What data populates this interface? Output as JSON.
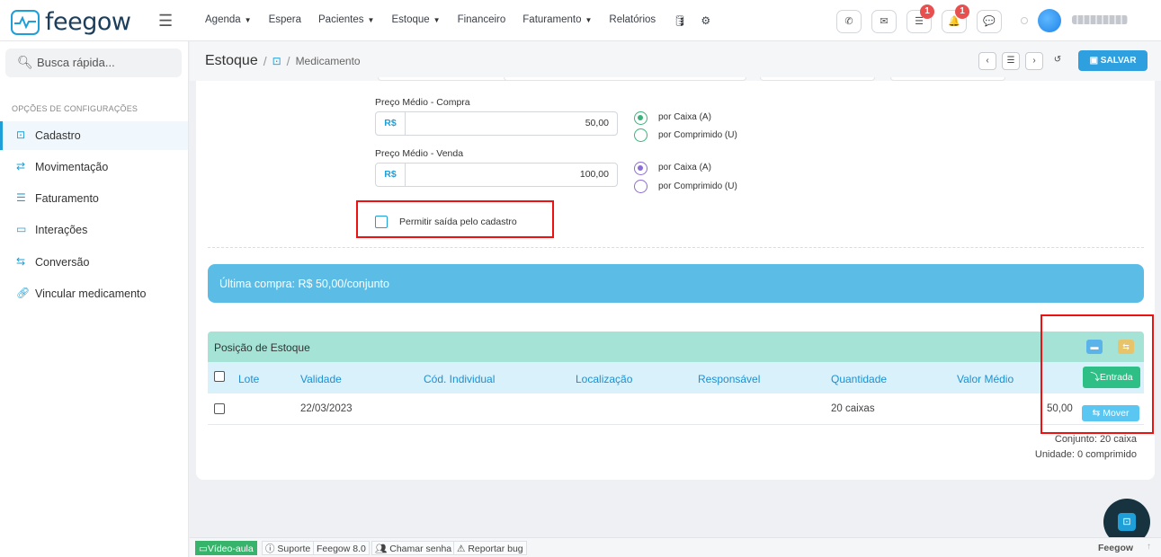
{
  "app": {
    "logo_text": "feegow"
  },
  "nav": {
    "items": [
      {
        "label": "Agenda",
        "caret": true
      },
      {
        "label": "Espera",
        "caret": false
      },
      {
        "label": "Pacientes",
        "caret": true
      },
      {
        "label": "Estoque",
        "caret": true
      },
      {
        "label": "Financeiro",
        "caret": false
      },
      {
        "label": "Faturamento",
        "caret": true
      },
      {
        "label": "Relatórios",
        "caret": false
      }
    ],
    "icons": [
      "database-icon",
      "gear-icon"
    ]
  },
  "topbar": {
    "buttons": [
      "phone-icon",
      "inbox-icon",
      "tasks-icon",
      "bell-icon",
      "chat-icon"
    ],
    "tasks_badge": "1",
    "bell_badge": "1"
  },
  "sidebar": {
    "search_placeholder": "Busca rápida...",
    "section_title": "OPÇÕES DE CONFIGURAÇÕES",
    "items": [
      {
        "label": "Cadastro",
        "icon": "box-icon",
        "active": true
      },
      {
        "label": "Movimentação",
        "icon": "arrows-icon",
        "active": false
      },
      {
        "label": "Faturamento",
        "icon": "list-icon",
        "active": false
      },
      {
        "label": "Interações",
        "icon": "folder-icon",
        "active": false
      },
      {
        "label": "Conversão",
        "icon": "convert-icon",
        "active": false
      },
      {
        "label": "Vincular medicamento",
        "icon": "link-icon",
        "active": false
      }
    ]
  },
  "breadcrumb": {
    "main": "Estoque",
    "sep": "/",
    "sub": "Medicamento"
  },
  "toolbar": {
    "save_label": "SALVAR"
  },
  "form": {
    "compra": {
      "label": "Preço Médio - Compra",
      "addon": "R$",
      "value": "50,00",
      "opt_a": "por Caixa (A)",
      "opt_u": "por Comprimido (U)"
    },
    "venda": {
      "label": "Preço Médio - Venda",
      "addon": "R$",
      "value": "100,00",
      "opt_a": "por Caixa (A)",
      "opt_u": "por Comprimido (U)"
    },
    "permitir_label": "Permitir saída pelo cadastro"
  },
  "info_banner": "Última compra: R$ 50,00/conjunto",
  "stock": {
    "title": "Posição de Estoque",
    "columns": [
      "Lote",
      "Validade",
      "Cód. Individual",
      "Localização",
      "Responsável",
      "Quantidade",
      "Valor Médio"
    ],
    "entrada_label": "Entrada",
    "rows": [
      {
        "lote": "",
        "validade": "22/03/2023",
        "cod": "",
        "localizacao": "",
        "responsavel": "",
        "quantidade": "20 caixas",
        "valor": "50,00",
        "action": "Mover"
      }
    ],
    "totals": {
      "conjunto": "Conjunto: 20 caixa",
      "unidade": "Unidade: 0 comprimido"
    }
  },
  "footer": {
    "items": [
      "Vídeo-aula",
      "Suporte",
      "Feegow 8.0",
      "Chamar senha",
      "Reportar bug"
    ],
    "right": "Feegow"
  },
  "colors": {
    "accent": "#1e9fd8",
    "success": "#2dbf86",
    "highlight": "#e11111",
    "info": "#5bbde6"
  }
}
